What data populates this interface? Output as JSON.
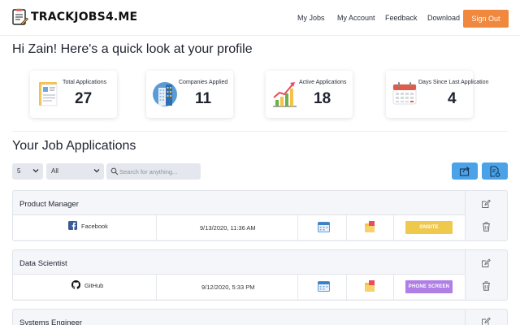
{
  "header": {
    "brand": "TRACKJOBS4.ME",
    "nav": [
      "My Jobs",
      "My Account",
      "Feedback",
      "Download"
    ],
    "sign_out": "Sign Out",
    "accent_color": "#f0883d"
  },
  "greeting": "Hi Zain! Here's a quick look at your profile",
  "stats": [
    {
      "label": "Total Applications",
      "value": "27",
      "icon": "clipboard-icon"
    },
    {
      "label": "Companies Applied",
      "value": "11",
      "icon": "building-icon"
    },
    {
      "label": "Active Applications",
      "value": "18",
      "icon": "growth-chart-icon"
    },
    {
      "label": "Days Since Last Application",
      "value": "4",
      "icon": "calendar-icon"
    }
  ],
  "applications": {
    "title": "Your Job Applications",
    "page_size": "5",
    "filter": "All",
    "search_placeholder": "Search for anything...",
    "jobs": [
      {
        "title": "Product Manager",
        "company": "Facebook",
        "date": "9/13/2020, 11:36 AM",
        "status": "ONSITE",
        "status_color": "#efc94c"
      },
      {
        "title": "Data Scientist",
        "company": "GitHub",
        "date": "9/12/2020, 5:33 PM",
        "status": "PHONE SCREEN",
        "status_color": "#b07fe6"
      },
      {
        "title": "Systems Engineer"
      }
    ]
  }
}
